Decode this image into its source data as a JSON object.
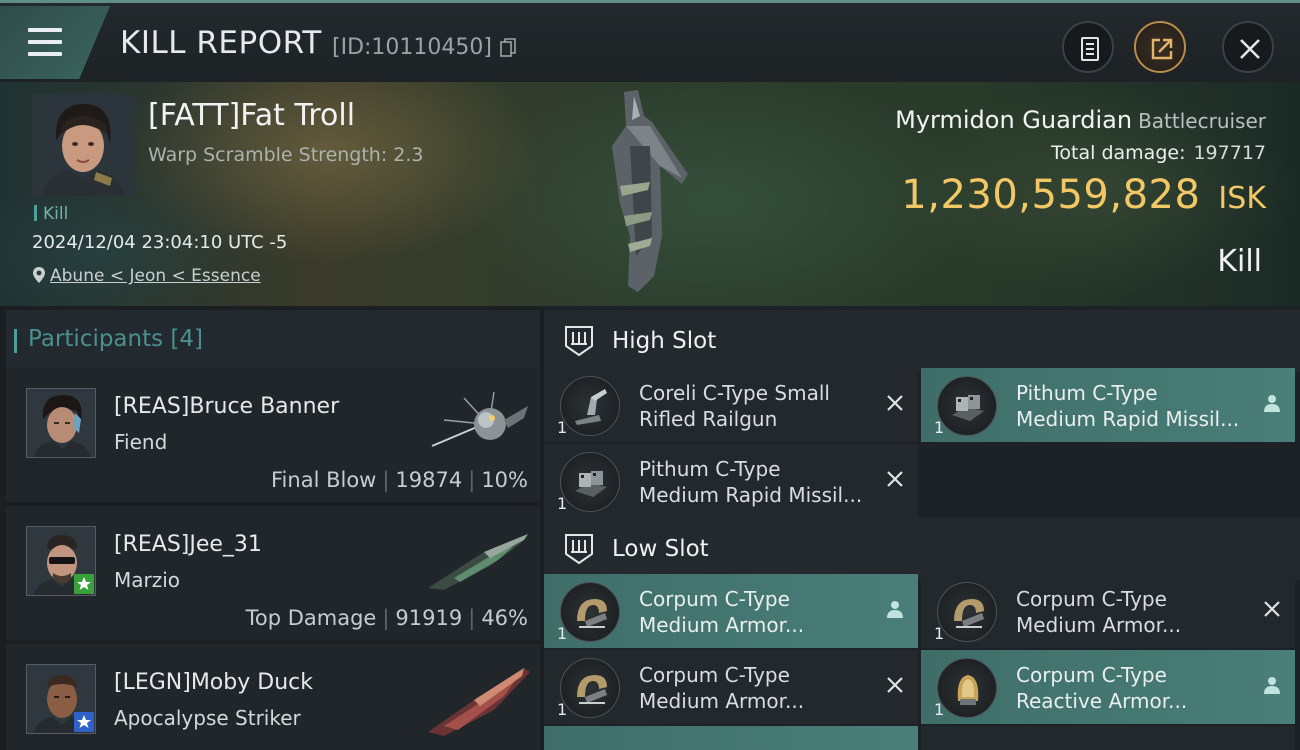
{
  "header": {
    "title": "KILL REPORT",
    "report_id": "[ID:10110450]"
  },
  "victim": {
    "name": "[FATT]Fat Troll",
    "warp_scramble": "Warp Scramble Strength: 2.3",
    "type_tag": "Kill",
    "datetime": "2024/12/04 23:04:10 UTC -5",
    "location": "Abune < Jeon < Essence",
    "ship_name": "Myrmidon Guardian",
    "ship_class": "Battlecruiser",
    "total_damage_label": "Total damage:",
    "total_damage": "197717",
    "isk_value": "1,230,559,828",
    "isk_unit": "ISK",
    "result": "Kill"
  },
  "participants": {
    "label": "Participants",
    "count": "[4]",
    "rows": [
      {
        "name": "[REAS]Bruce Banner",
        "ship": "Fiend",
        "role": "Final Blow",
        "damage": "19874",
        "percent": "10%"
      },
      {
        "name": "[REAS]Jee_31",
        "ship": "Marzio",
        "role": "Top Damage",
        "damage": "91919",
        "percent": "46%"
      },
      {
        "name": "[LEGN]Moby Duck",
        "ship": "Apocalypse Striker",
        "role": "",
        "damage": "",
        "percent": ""
      }
    ]
  },
  "fitting": {
    "high_slot_label": "High Slot",
    "low_slot_label": "Low Slot",
    "high": [
      {
        "line1": "Coreli C-Type Small",
        "line2": "Rifled Railgun",
        "qty": "1",
        "status": "destroyed"
      },
      {
        "line1": "Pithum C-Type",
        "line2": "Medium Rapid Missil...",
        "qty": "1",
        "status": "dropped"
      },
      {
        "line1": "Pithum C-Type",
        "line2": "Medium Rapid Missil...",
        "qty": "1",
        "status": "destroyed"
      }
    ],
    "low": [
      {
        "line1": "Corpum C-Type",
        "line2": "Medium Armor...",
        "qty": "1",
        "status": "dropped"
      },
      {
        "line1": "Corpum C-Type",
        "line2": "Medium Armor...",
        "qty": "1",
        "status": "destroyed"
      },
      {
        "line1": "Corpum C-Type",
        "line2": "Medium Armor...",
        "qty": "1",
        "status": "destroyed"
      },
      {
        "line1": "Corpum C-Type",
        "line2": "Reactive Armor...",
        "qty": "1",
        "status": "dropped"
      }
    ]
  },
  "colors": {
    "accent_teal": "#4e9f98",
    "isk_gold": "#f2c867",
    "dropped_bg": "#4a7e78"
  }
}
